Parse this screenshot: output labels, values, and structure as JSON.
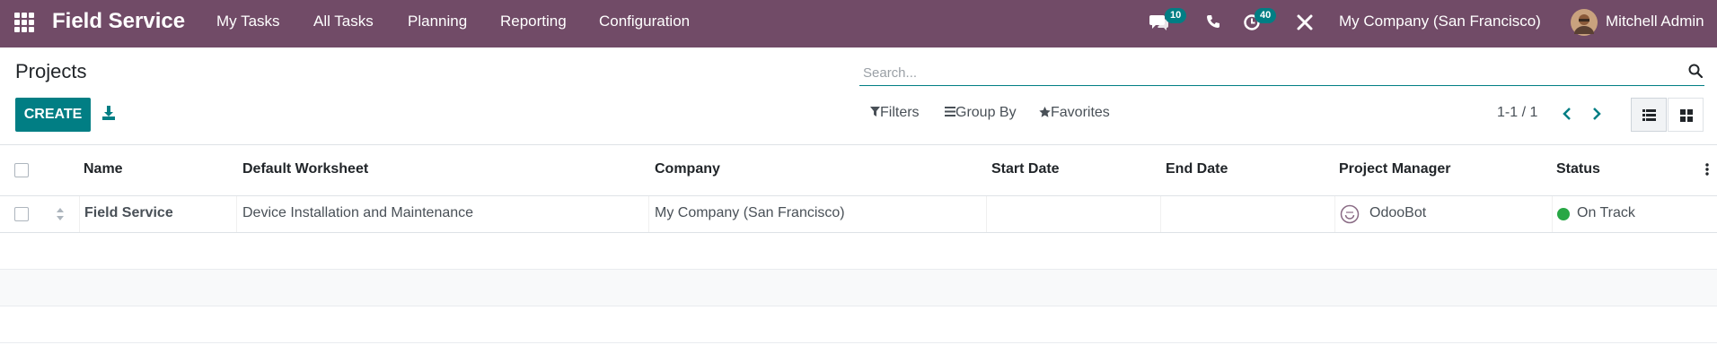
{
  "navbar": {
    "app_name": "Field Service",
    "menu": [
      "My Tasks",
      "All Tasks",
      "Planning",
      "Reporting",
      "Configuration"
    ],
    "messages_count": "10",
    "activities_count": "40",
    "company": "My Company (San Francisco)",
    "user": "Mitchell Admin",
    "color": "#714b67"
  },
  "control_panel": {
    "title": "Projects",
    "create_label": "CREATE",
    "search_placeholder": "Search...",
    "filters_label": "Filters",
    "group_by_label": "Group By",
    "favorites_label": "Favorites",
    "pager": "1-1 / 1"
  },
  "table": {
    "columns": [
      "Name",
      "Default Worksheet",
      "Company",
      "Start Date",
      "End Date",
      "Project Manager",
      "Status"
    ],
    "rows": [
      {
        "name": "Field Service",
        "worksheet": "Device Installation and Maintenance",
        "company": "My Company (San Francisco)",
        "start_date": "",
        "end_date": "",
        "manager": "OdooBot",
        "status": "On Track",
        "status_color": "#28a745"
      }
    ]
  },
  "accent_color": "#017e84"
}
